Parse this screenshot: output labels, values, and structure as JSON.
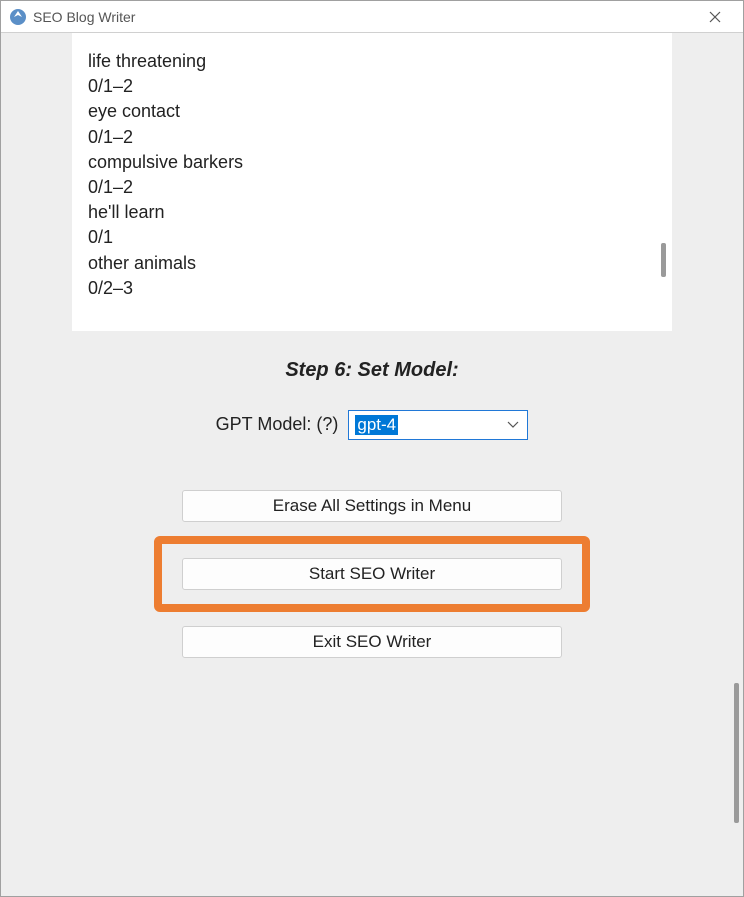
{
  "window": {
    "title": "SEO Blog Writer"
  },
  "text_panel": {
    "lines": [
      "life threatening",
      "0/1–2",
      "eye contact",
      "0/1–2",
      "compulsive barkers",
      "0/1–2",
      "he'll learn",
      "0/1",
      "other animals",
      "0/2–3"
    ]
  },
  "step": {
    "heading": "Step 6: Set Model:"
  },
  "model": {
    "label": "GPT Model: (?)",
    "selected": "gpt-4"
  },
  "buttons": {
    "erase": "Erase All Settings in Menu",
    "start": "Start SEO Writer",
    "exit": "Exit SEO Writer"
  }
}
